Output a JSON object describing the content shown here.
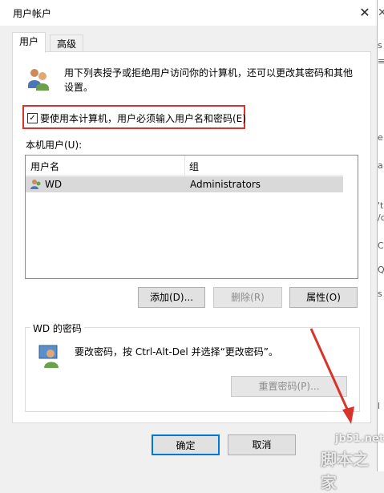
{
  "window": {
    "title": "用户帐户",
    "close_glyph": "✕"
  },
  "tabs": [
    {
      "label": "用户",
      "active": true
    },
    {
      "label": "高级",
      "active": false
    }
  ],
  "description": "用下列表授予或拒绝用户访问你的计算机，还可以更改其密码和其他设置。",
  "checkbox": {
    "label": "要使用本计算机，用户必须输入用户名和密码(E)",
    "checked": true,
    "glyph": "✓",
    "highlight_color": "#d9342b"
  },
  "local_users_label": "本机用户(U):",
  "table": {
    "columns": [
      "用户名",
      "组"
    ],
    "rows": [
      {
        "name": "WD",
        "group": "Administrators"
      }
    ]
  },
  "buttons": {
    "add": "添加(D)...",
    "remove": "删除(R)",
    "properties": "属性(O)",
    "reset_password": "重置密码(P)...",
    "ok": "确定",
    "cancel": "取消"
  },
  "password_group": {
    "title": "WD 的密码",
    "text": "要改密码，按 Ctrl-Alt-Del 并选择“更改密码”。"
  },
  "icons": [
    "users-icon",
    "user-row-icon",
    "user-key-icon",
    "close-icon",
    "checkmark-icon"
  ],
  "edge_glyphs": [
    "✕",
    "s",
    "≡",
    "e",
    "a",
    "'t",
    "/c",
    "C",
    "Q",
    "s",
    "l"
  ],
  "watermark": {
    "url": "jb51.net",
    "name": "脚本之家"
  },
  "colors": {
    "accent": "#d9342b",
    "selection": "#d9d9d9",
    "dialog_bg": "#f0f0f0"
  }
}
